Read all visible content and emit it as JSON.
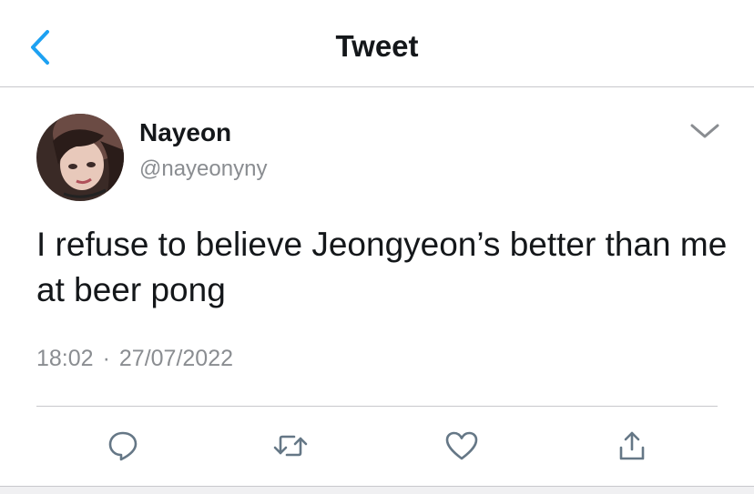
{
  "nav": {
    "title": "Tweet",
    "back_icon": "chevron-left-icon"
  },
  "tweet": {
    "author": {
      "display_name": "Nayeon",
      "handle": "@nayeonyny"
    },
    "text": "I refuse to believe Jeongyeon’s better than me at beer pong",
    "time": "18:02",
    "separator": "·",
    "date": "27/07/2022"
  },
  "actions": [
    {
      "name": "reply",
      "icon": "reply-icon"
    },
    {
      "name": "retweet",
      "icon": "retweet-icon"
    },
    {
      "name": "like",
      "icon": "heart-icon"
    },
    {
      "name": "share",
      "icon": "share-icon"
    }
  ],
  "colors": {
    "accent": "#1da1f2",
    "text": "#14171a",
    "secondary": "#8a8d91",
    "icon_gray": "#657786",
    "divider": "#c8c8cc"
  }
}
